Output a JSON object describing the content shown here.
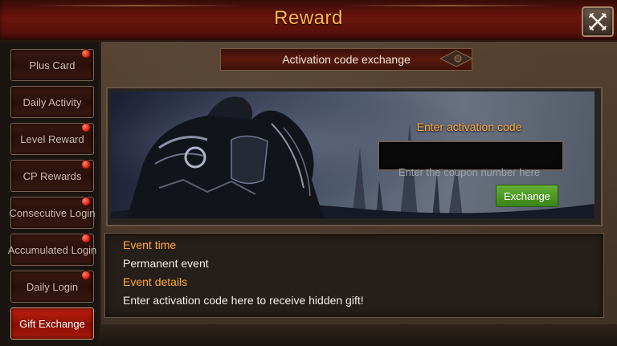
{
  "header": {
    "title": "Reward"
  },
  "sidebar": {
    "items": [
      {
        "label": "Plus Card",
        "has_notification": true,
        "active": false
      },
      {
        "label": "Daily Activity",
        "has_notification": false,
        "active": false
      },
      {
        "label": "Level Reward",
        "has_notification": true,
        "active": false
      },
      {
        "label": "CP Rewards",
        "has_notification": true,
        "active": false
      },
      {
        "label": "Consecutive Login",
        "has_notification": true,
        "active": false
      },
      {
        "label": "Accumulated Login",
        "has_notification": true,
        "active": false
      },
      {
        "label": "Daily Login",
        "has_notification": true,
        "active": false
      },
      {
        "label": "Gift Exchange",
        "has_notification": false,
        "active": true
      }
    ]
  },
  "main": {
    "section_title": "Activation code exchange",
    "code_form": {
      "label": "Enter activation code",
      "input_value": "",
      "placeholder": "Enter the coupon number here",
      "button_label": "Exchange"
    },
    "info": {
      "time_label": "Event time",
      "time_value": "Permanent event",
      "details_label": "Event details",
      "details_value": "Enter activation code here to receive hidden gift!"
    }
  },
  "colors": {
    "title_text": "#ffb44a",
    "accent_orange": "#ffa83a",
    "active_tab_red": "#c4200f",
    "exchange_green": "#4a9a22",
    "notification_red": "#e02010"
  },
  "icons": {
    "close": "close-crossed-swords-icon",
    "notification": "notification-dot-icon"
  }
}
